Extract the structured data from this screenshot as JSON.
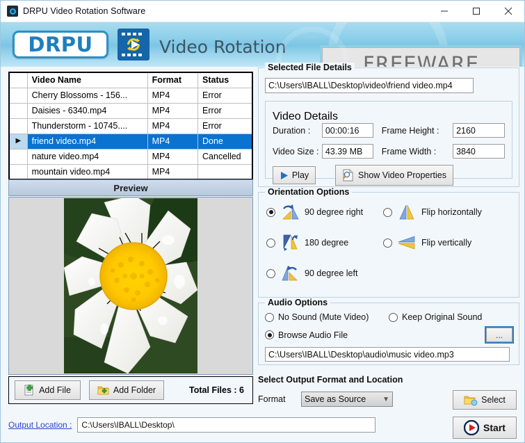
{
  "window": {
    "title": "DRPU Video Rotation Software",
    "icon": "app-icon",
    "minimize": "–",
    "maximize": "□",
    "close": "✕"
  },
  "banner": {
    "logo_text": "DRPU",
    "title": "Video Rotation",
    "badge": "FREEWARE",
    "accent_color": "#8fd0ea"
  },
  "file_table": {
    "columns": [
      "",
      "Video Name",
      "Format",
      "Status"
    ],
    "rows": [
      {
        "mark": "",
        "name": "Cherry Blossoms - 156...",
        "format": "MP4",
        "status": "Error",
        "selected": false
      },
      {
        "mark": "",
        "name": "Daisies - 6340.mp4",
        "format": "MP4",
        "status": "Error",
        "selected": false
      },
      {
        "mark": "",
        "name": "Thunderstorm - 10745....",
        "format": "MP4",
        "status": "Error",
        "selected": false
      },
      {
        "mark": "▶",
        "name": "friend video.mp4",
        "format": "MP4",
        "status": "Done",
        "selected": true
      },
      {
        "mark": "",
        "name": "nature video.mp4",
        "format": "MP4",
        "status": "Cancelled",
        "selected": false
      },
      {
        "mark": "",
        "name": "mountain video.mp4",
        "format": "MP4",
        "status": "",
        "selected": false
      }
    ],
    "selected_row_color": "#0a72cf"
  },
  "preview": {
    "header": "Preview",
    "image_alt": "daisy-flower-preview"
  },
  "add_bar": {
    "add_file": "Add File",
    "add_folder": "Add Folder",
    "total_files": "Total Files : 6"
  },
  "output_location": {
    "label": "Output Location :",
    "value": "C:\\Users\\IBALL\\Desktop\\"
  },
  "selected_file_details": {
    "legend": "Selected File Details",
    "path": "C:\\Users\\IBALL\\Desktop\\video\\friend video.mp4",
    "video_details": {
      "legend": "Video Details",
      "duration_label": "Duration :",
      "duration_value": "00:00:16",
      "frame_height_label": "Frame Height :",
      "frame_height_value": "2160",
      "video_size_label": "Video Size :",
      "video_size_value": "43.39 MB",
      "frame_width_label": "Frame Width :",
      "frame_width_value": "3840",
      "play_button": "Play",
      "properties_button": "Show Video Properties"
    }
  },
  "orientation_options": {
    "legend": "Orientation Options",
    "items": [
      {
        "label": "90 degree right",
        "selected": true,
        "icon": "rotate-right-icon"
      },
      {
        "label": "Flip horizontally",
        "selected": false,
        "icon": "flip-horizontal-icon"
      },
      {
        "label": "180 degree",
        "selected": false,
        "icon": "rotate-180-icon"
      },
      {
        "label": "Flip vertically",
        "selected": false,
        "icon": "flip-vertical-icon"
      },
      {
        "label": "90 degree left",
        "selected": false,
        "icon": "rotate-left-icon"
      }
    ]
  },
  "audio_options": {
    "legend": "Audio Options",
    "no_sound": "No Sound (Mute Video)",
    "keep_original": "Keep Original Sound",
    "browse_audio": "Browse Audio File",
    "browse_button": "...",
    "audio_path": "C:\\Users\\IBALL\\Desktop\\audio\\music video.mp3",
    "selected": "Browse Audio File"
  },
  "output_section": {
    "title": "Select Output Format and Location",
    "format_label": "Format",
    "format_value": "Save as Source",
    "select_button": "Select",
    "start_button": "Start"
  }
}
